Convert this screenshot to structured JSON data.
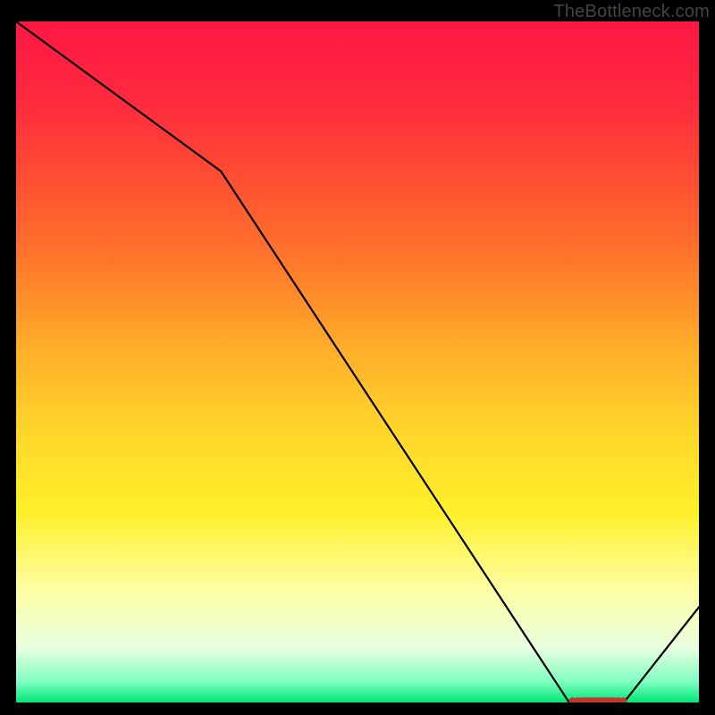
{
  "watermark": "TheBottleneck.com",
  "chart_data": {
    "type": "line",
    "title": "",
    "xlabel": "",
    "ylabel": "",
    "xlim": [
      0,
      100
    ],
    "ylim": [
      0,
      100
    ],
    "grid": false,
    "legend": false,
    "x": [
      0,
      30,
      81,
      89,
      100
    ],
    "y": [
      100,
      78,
      0,
      0,
      14
    ],
    "valley_markers_x": [
      81.5,
      82.2,
      82.8,
      83.3,
      83.8,
      84.3,
      84.8,
      85.2,
      85.7,
      86.1,
      86.6,
      87.1,
      87.6,
      88.2,
      88.9
    ],
    "valley_markers_y": 0.2,
    "marker_color": "#c0392b",
    "line_color": "#000000",
    "gradient_stops": [
      {
        "offset": 0.0,
        "color": "#ff1744"
      },
      {
        "offset": 0.12,
        "color": "#ff2b3e"
      },
      {
        "offset": 0.24,
        "color": "#ff5131"
      },
      {
        "offset": 0.36,
        "color": "#ff7a2a"
      },
      {
        "offset": 0.48,
        "color": "#ffae2a"
      },
      {
        "offset": 0.6,
        "color": "#ffd52a"
      },
      {
        "offset": 0.72,
        "color": "#fff02a"
      },
      {
        "offset": 0.84,
        "color": "#fdffa8"
      },
      {
        "offset": 0.92,
        "color": "#e8ffe0"
      },
      {
        "offset": 0.97,
        "color": "#7effc0"
      },
      {
        "offset": 1.0,
        "color": "#00e676"
      }
    ]
  }
}
